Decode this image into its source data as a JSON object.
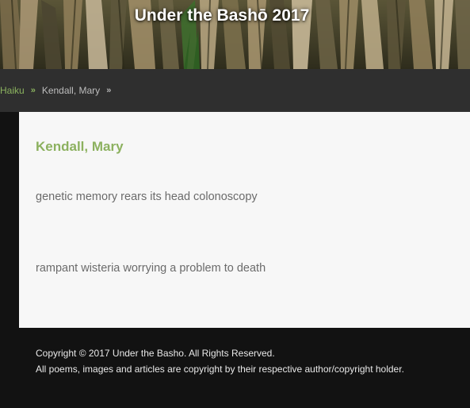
{
  "header": {
    "site_title": "Under the Bashō 2017"
  },
  "breadcrumb": {
    "items": [
      {
        "label": "Haiku"
      },
      {
        "label": "Kendall, Mary"
      }
    ]
  },
  "main": {
    "author_title": "Kendall, Mary",
    "poems": [
      "genetic memory rears its head colonoscopy",
      "rampant wisteria worrying a problem to death"
    ]
  },
  "footer": {
    "copyright": "Copyright © 2017 Under the Basho. All Rights Reserved.",
    "notice": "All poems, images and articles are copyright by their respective author/copyright holder."
  },
  "colors": {
    "accent_green": "#8cb15f",
    "breadcrumb_bar": "#2f2f2f",
    "page_background": "#121212",
    "content_background": "#f7f7f7"
  }
}
